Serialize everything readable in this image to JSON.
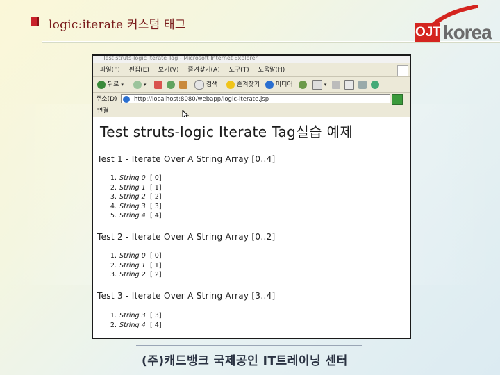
{
  "slide": {
    "title": "logic:iterate 커스텀 태그",
    "logo_left": "OJT",
    "logo_right": "korea",
    "footer": "(주)캐드뱅크 국제공인 IT트레이닝 센터"
  },
  "browser": {
    "window_title": "Test struts-logic Iterate Tag - Microsoft Internet Explorer",
    "menu": [
      "파일(F)",
      "편집(E)",
      "보기(V)",
      "즐겨찾기(A)",
      "도구(T)",
      "도움말(H)"
    ],
    "toolbar": {
      "back": "뒤로",
      "search": "검색",
      "favorites": "즐겨찾기",
      "media": "미디어"
    },
    "address": {
      "label": "주소(D)",
      "url": "http://localhost:8080/webapp/logic-iterate.jsp"
    },
    "links_label": "연결"
  },
  "page": {
    "heading": "Test struts-logic Iterate Tag실습 예제",
    "tests": [
      {
        "heading": "Test 1 - Iterate Over A String Array [0..4]",
        "items": [
          {
            "num": "1.",
            "text": "String 0",
            "bracket": "[ 0]"
          },
          {
            "num": "2.",
            "text": "String 1",
            "bracket": "[ 1]"
          },
          {
            "num": "3.",
            "text": "String 2",
            "bracket": "[ 2]"
          },
          {
            "num": "4.",
            "text": "String 3",
            "bracket": "[ 3]"
          },
          {
            "num": "5.",
            "text": "String 4",
            "bracket": "[ 4]"
          }
        ]
      },
      {
        "heading": "Test 2 - Iterate Over A String Array [0..2]",
        "items": [
          {
            "num": "1.",
            "text": "String 0",
            "bracket": "[ 0]"
          },
          {
            "num": "2.",
            "text": "String 1",
            "bracket": "[ 1]"
          },
          {
            "num": "3.",
            "text": "String 2",
            "bracket": "[ 2]"
          }
        ]
      },
      {
        "heading": "Test 3 - Iterate Over A String Array [3..4]",
        "items": [
          {
            "num": "1.",
            "text": "String 3",
            "bracket": "[ 3]"
          },
          {
            "num": "2.",
            "text": "String 4",
            "bracket": "[ 4]"
          }
        ]
      }
    ]
  }
}
